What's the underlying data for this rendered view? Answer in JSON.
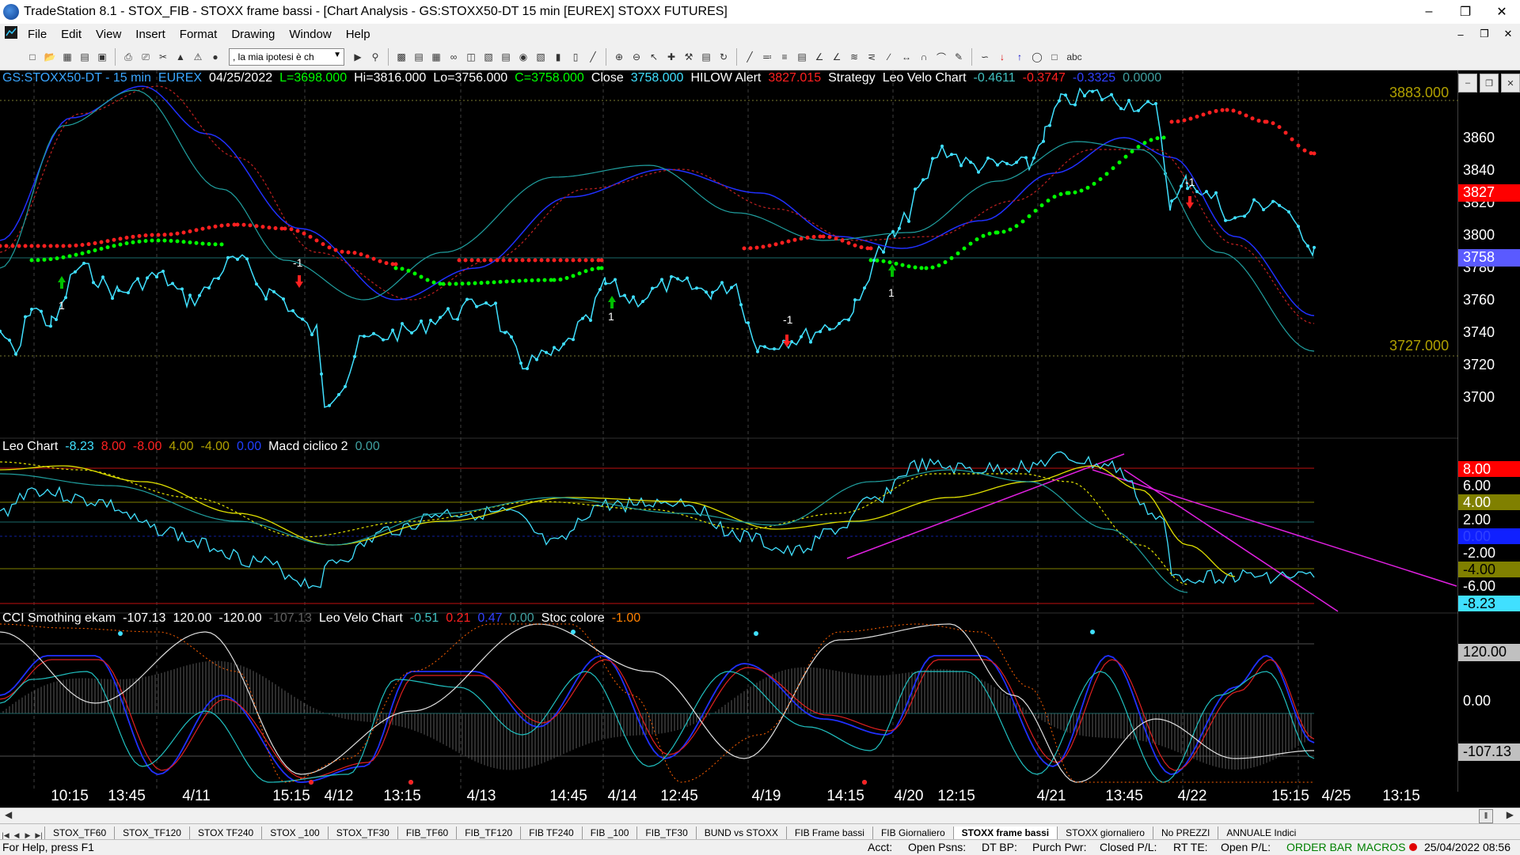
{
  "window": {
    "title": "TradeStation 8.1 - STOX_FIB - STOXX frame bassi - [Chart Analysis - GS:STOXX50-DT  15 min  [EUREX] STOXX FUTURES]",
    "minimize": "‒",
    "restore": "❐",
    "close": "✕"
  },
  "menu": [
    "File",
    "Edit",
    "View",
    "Insert",
    "Format",
    "Drawing",
    "Window",
    "Help"
  ],
  "toolbar": {
    "combo_value": ", la mia ipotesi è ch",
    "text_tool": "abc"
  },
  "header_price": [
    {
      "t": "GS:STOXX50-DT - 15 min",
      "c": "#3aa6ff"
    },
    {
      "t": "EUREX",
      "c": "#3aa6ff"
    },
    {
      "t": "04/25/2022",
      "c": "#ffffff"
    },
    {
      "t": "L=3698.000",
      "c": "#00ff00"
    },
    {
      "t": "Hi=3816.000",
      "c": "#ffffff"
    },
    {
      "t": "Lo=3756.000",
      "c": "#ffffff"
    },
    {
      "t": "C=3758.000",
      "c": "#00ff00"
    },
    {
      "t": "Close",
      "c": "#ffffff"
    },
    {
      "t": "3758.000",
      "c": "#40e0ff"
    },
    {
      "t": "HILOW Alert",
      "c": "#ffffff"
    },
    {
      "t": "3827.015",
      "c": "#ff2020"
    },
    {
      "t": "Strategy",
      "c": "#ffffff"
    },
    {
      "t": "Leo Velo Chart",
      "c": "#ffffff"
    },
    {
      "t": "-0.4611",
      "c": "#40c0c0"
    },
    {
      "t": "-0.3747",
      "c": "#ff2020"
    },
    {
      "t": "-0.3325",
      "c": "#3040ff"
    },
    {
      "t": "0.0000",
      "c": "#40a0a0"
    }
  ],
  "header_leo": [
    {
      "t": "Leo Chart",
      "c": "#ffffff"
    },
    {
      "t": "-8.23",
      "c": "#40e0ff"
    },
    {
      "t": "8.00",
      "c": "#ff2020"
    },
    {
      "t": "-8.00",
      "c": "#ff2020"
    },
    {
      "t": "4.00",
      "c": "#b0a000"
    },
    {
      "t": "-4.00",
      "c": "#b0a000"
    },
    {
      "t": "0.00",
      "c": "#2040ff"
    },
    {
      "t": "Macd ciclico 2",
      "c": "#ffffff"
    },
    {
      "t": "0.00",
      "c": "#40a0a0"
    }
  ],
  "header_cci": [
    {
      "t": "CCI Smothing ekam",
      "c": "#ffffff"
    },
    {
      "t": "-107.13",
      "c": "#ffffff"
    },
    {
      "t": "120.00",
      "c": "#ffffff"
    },
    {
      "t": "-120.00",
      "c": "#ffffff"
    },
    {
      "t": "-107.13",
      "c": "#606060"
    },
    {
      "t": "Leo Velo Chart",
      "c": "#ffffff"
    },
    {
      "t": "-0.51",
      "c": "#40c0c0"
    },
    {
      "t": "0.21",
      "c": "#ff2020"
    },
    {
      "t": "0.47",
      "c": "#3040ff"
    },
    {
      "t": "0.00",
      "c": "#40a0a0"
    },
    {
      "t": "Stoc colore",
      "c": "#ffffff"
    },
    {
      "t": "-1.00",
      "c": "#ff8000"
    }
  ],
  "price_levels": {
    "upper": "3883.000",
    "lower": "3727.000"
  },
  "price_axis": [
    "3860",
    "3840",
    "3820",
    "3800",
    "3780",
    "3760",
    "3740",
    "3720",
    "3700"
  ],
  "price_badges": {
    "hilow": "3827",
    "last": "3758"
  },
  "leo_axis": [
    "6.00",
    "4.00",
    "2.00",
    "0.00",
    "-2.00",
    "-4.00",
    "-6.00"
  ],
  "leo_badges": {
    "upper": "8.00",
    "last": "-8.23"
  },
  "cci_axis": [
    "120.00",
    "0.00",
    "-107.13"
  ],
  "signals": [
    "1",
    "-1",
    "1",
    "-1",
    "1",
    "-1"
  ],
  "time_axis": [
    "10:15",
    "13:45",
    "4/11",
    "15:15",
    "4/12",
    "13:15",
    "4/13",
    "14:45",
    "4/14",
    "12:45",
    "4/19",
    "14:15",
    "4/20",
    "12:15",
    "4/21",
    "13:45",
    "4/22",
    "15:15",
    "4/25",
    "13:15"
  ],
  "workspace_tabs": [
    "STOX_TF60",
    "STOX_TF120",
    "STOX TF240",
    "STOX _100",
    "STOX_TF30",
    "FIB_TF60",
    "FIB_TF120",
    "FIB TF240",
    "FIB _100",
    "FIB_TF30",
    "BUND vs STOXX",
    "FIB Frame bassi",
    "FIB Giornaliero",
    "STOXX frame bassi",
    "STOXX giornaliero",
    "No PREZZI",
    "ANNUALE Indici"
  ],
  "active_tab": "STOXX frame bassi",
  "status": {
    "help": "For Help, press F1",
    "acct": "Acct:",
    "open_psns": "Open Psns:",
    "dt_bp": "DT BP:",
    "purch_pwr": "Purch Pwr:",
    "closed_pl": "Closed P/L:",
    "rt_te": "RT TE:",
    "open_pl": "Open P/L:",
    "order_bar": "ORDER BAR",
    "macros": "MACROS",
    "datetime": "25/04/2022 08:56"
  },
  "colors": {
    "price": "#40e0ff",
    "support": "#00ff00",
    "resistance": "#ff2020",
    "macd": "#e0e000",
    "trendline": "#e020e0",
    "bg": "#000000"
  }
}
